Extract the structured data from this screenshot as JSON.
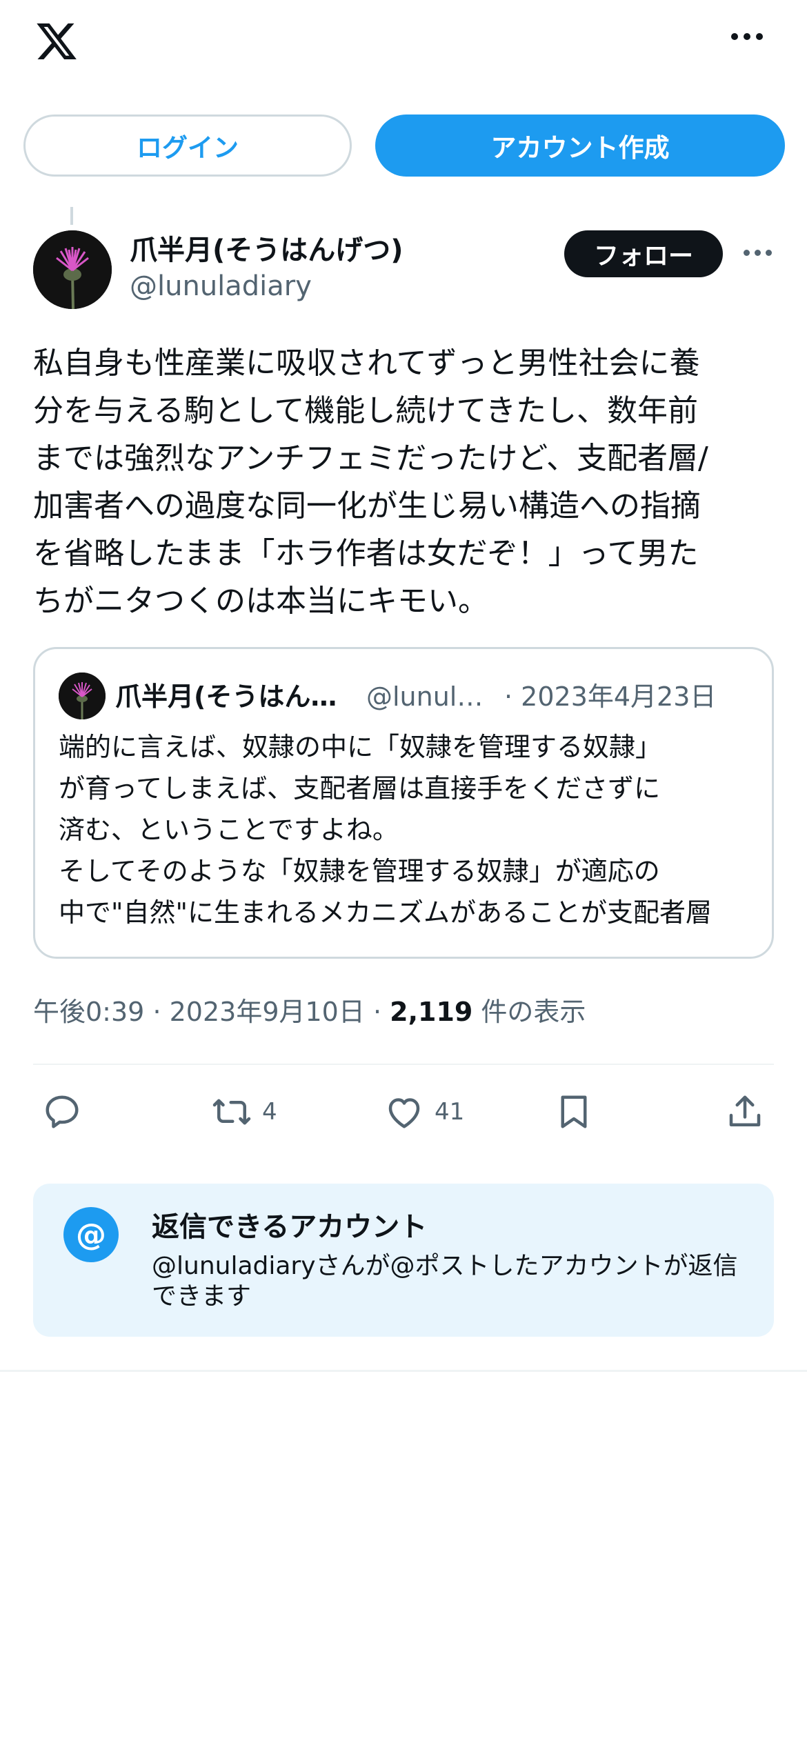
{
  "header": {
    "logo_icon": "x-logo-icon",
    "more_icon": "more-horizontal-icon"
  },
  "auth": {
    "login_label": "ログイン",
    "signup_label": "アカウント作成"
  },
  "post": {
    "display_name": "爪半月(そうはんげつ)",
    "handle": "@lunuladiary",
    "follow_label": "フォロー",
    "text": "私自身も性産業に吸収されてずっと男性社会に養\n分を与える駒として機能し続けてきたし、数年前\nまでは強烈なアンチフェミだったけど、支配者層/\n加害者への過度な同一化が生じ易い構造への指摘\nを省略したまま「ホラ作者は女だぞ！」って男た\nちがニタつくのは本当にキモい。",
    "time": "午後0:39",
    "date": "2023年9月10日",
    "views_count": "2,119",
    "views_label": "件の表示",
    "actions": {
      "reply_count": "",
      "repost_count": "4",
      "like_count": "41"
    }
  },
  "quote": {
    "display_name": "爪半月(そうはんげつ)",
    "handle": "@lunuladiary",
    "date": "· 2023年4月23日",
    "lines": [
      "端的に言えば、奴隷の中に「奴隷を管理する奴隷」",
      "が育ってしまえば、支配者層は直接手をくださずに",
      "済む、ということですよね。",
      "そしてそのような「奴隷を管理する奴隷」が適応の",
      "中で\"自然\"に生まれるメカニズムがあることが支配者層"
    ]
  },
  "reply_settings": {
    "title": "返信できるアカウント",
    "description": "@lunuladiaryさんが@ポストしたアカウントが返信できます",
    "icon_text": "@"
  },
  "colors": {
    "accent": "#1d9bf0",
    "text_primary": "#0f1419",
    "text_secondary": "#536471",
    "reply_box_bg": "#e8f5fd"
  }
}
